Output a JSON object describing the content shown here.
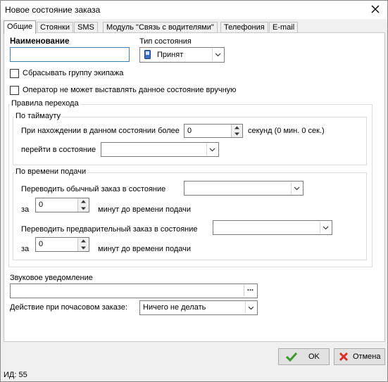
{
  "window": {
    "title": "Новое состояние заказа"
  },
  "tabs": [
    {
      "label": "Общие"
    },
    {
      "label": "Стоянки"
    },
    {
      "label": "SMS"
    },
    {
      "label": "Модуль \"Связь с водителями\""
    },
    {
      "label": "Телефония"
    },
    {
      "label": "E-mail"
    }
  ],
  "general": {
    "name_label": "Наименование",
    "name_value": "",
    "state_type_label": "Тип состояния",
    "state_type_value": "Принят",
    "reset_crew_group_label": "Сбрасывать группу экипажа",
    "operator_cannot_set_label": "Оператор не может выставлять данное состояние вручную"
  },
  "transition_rules": {
    "title": "Правила перехода",
    "timeout": {
      "title": "По таймауту",
      "while_in_state_label": "При нахождении в данном состоянии более",
      "seconds_value": "0",
      "seconds_suffix": "секунд  (0 мин. 0 сек.)",
      "goto_state_label": "перейти в состояние",
      "goto_state_value": ""
    },
    "by_pickup_time": {
      "title": "По времени подачи",
      "regular_label": "Переводить обычный заказ в состояние",
      "regular_value": "",
      "regular_prefix": "за",
      "regular_minutes": "0",
      "regular_suffix": "минут до времени подачи",
      "prior_label": "Переводить предварительный заказ в состояние",
      "prior_value": "",
      "prior_prefix": "за",
      "prior_minutes": "0",
      "prior_suffix": "минут до времени подачи"
    }
  },
  "sound": {
    "label": "Звуковое уведомление",
    "value": "",
    "browse_label": "..."
  },
  "hourly": {
    "label": "Действие при почасовом заказе:",
    "value": "Ничего не делать"
  },
  "buttons": {
    "ok_label": "OK",
    "cancel_label": "Отмена"
  },
  "status": {
    "id_text": "ИД: 55"
  },
  "colors": {
    "ok_check": "#3a9a2b",
    "cancel_x": "#d9322a",
    "focus_border": "#3c7fb1"
  }
}
